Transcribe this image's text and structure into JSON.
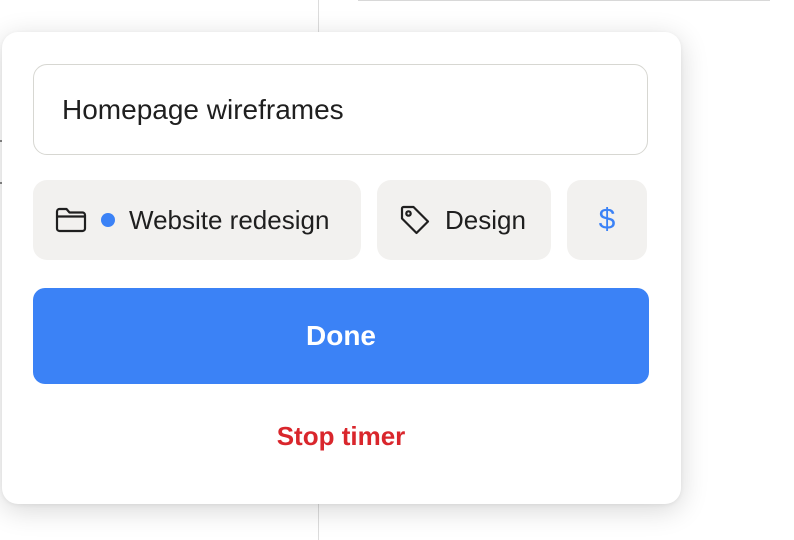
{
  "timer_entry": {
    "description": "Homepage wireframes",
    "project": {
      "name": "Website redesign",
      "color": "#3b82f6",
      "icon": "folder-icon"
    },
    "tag": {
      "name": "Design",
      "icon": "tag-icon"
    },
    "billable": {
      "symbol": "$",
      "color": "#3b82f6"
    },
    "done_label": "Done",
    "stop_label": "Stop timer"
  },
  "colors": {
    "accent": "#3b82f6",
    "danger": "#d9262c",
    "chip_bg": "#f2f1ef"
  }
}
